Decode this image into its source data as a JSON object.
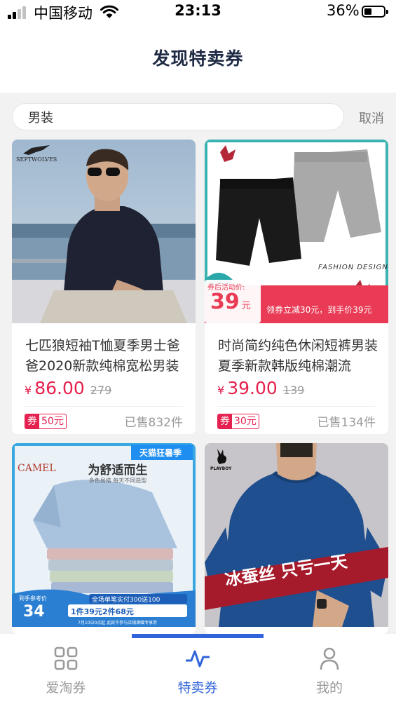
{
  "status_bar": {
    "carrier": "中国移动",
    "time": "23:13",
    "battery": "36%"
  },
  "header": {
    "title": "发现特卖券"
  },
  "search": {
    "value": "男装",
    "placeholder": "",
    "cancel_label": "取消"
  },
  "products": [
    {
      "image_text": "SEPTWOLVES",
      "title": "七匹狼短袖T恤夏季男士爸爸2020新款纯棉宽松男装",
      "price": "86.00",
      "currency": "¥",
      "original_price": "279",
      "coupon_tag": "券",
      "coupon_amount": "50元",
      "sold": "已售832件"
    },
    {
      "image_text": "FASHION DESIGN",
      "promo_label": "券后活动价:",
      "promo_price": "39",
      "promo_unit": "元",
      "promo_banner": "领券立减30元，到手价39元",
      "title": "时尚简约纯色休闲短裤男装夏季新款韩版纯棉潮流",
      "price": "39.00",
      "currency": "¥",
      "original_price": "139",
      "coupon_tag": "券",
      "coupon_amount": "30元",
      "sold": "已售134件"
    },
    {
      "image_brand": "CAMEL",
      "image_badge": "天猫狂暑季",
      "image_headline": "为舒适而生",
      "image_sub": "多色易搭 每天不同造型",
      "image_price_label": "到手参考价",
      "image_price": "34",
      "image_promo1": "全场单笔实付300送100",
      "image_promo2": "1件39元2件68元",
      "image_footer": "7月10日0点起 此款不参与店铺满赠专享券",
      "title": "",
      "price": "",
      "sold": ""
    },
    {
      "image_brand": "PLAYBOY",
      "image_banner": "冰蚕丝 只亏一天",
      "title": "",
      "price": "",
      "sold": ""
    }
  ],
  "tabs": [
    {
      "label": "爱淘券",
      "icon": "grid-icon",
      "active": false
    },
    {
      "label": "特卖券",
      "icon": "pulse-icon",
      "active": true
    },
    {
      "label": "我的",
      "icon": "user-icon",
      "active": false
    }
  ],
  "colors": {
    "accent": "#2f63d9",
    "price": "#e5224f",
    "title": "#1f2a44"
  }
}
